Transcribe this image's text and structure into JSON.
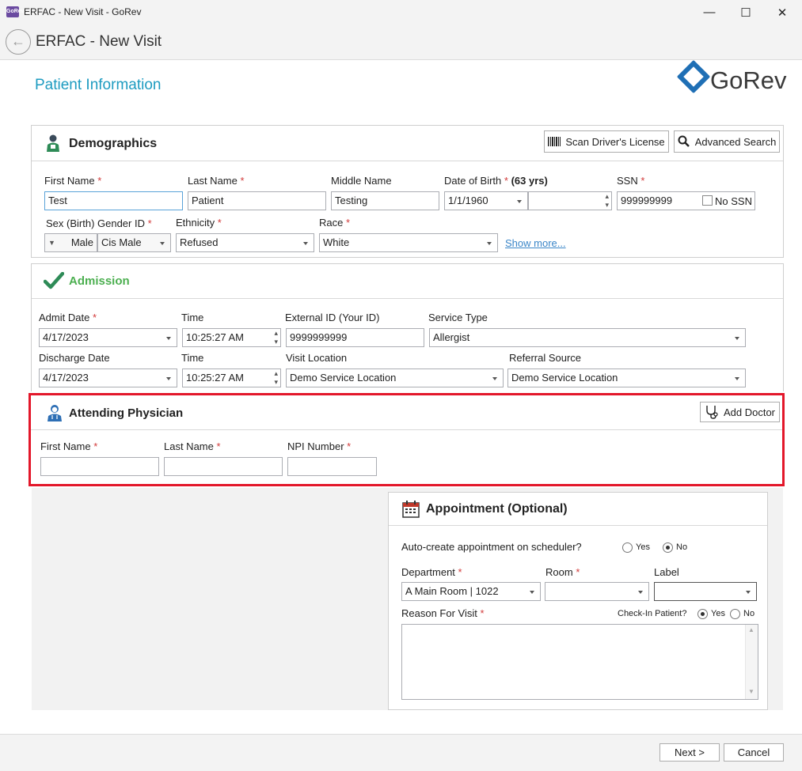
{
  "window": {
    "title": "ERFAC - New Visit - GoRev",
    "app_icon": "GoRev",
    "minimize": "—",
    "maximize": "☐",
    "close": "✕"
  },
  "header": {
    "title": "ERFAC - New Visit",
    "back_icon": "←"
  },
  "page": {
    "title": "Patient Information",
    "logo_text": "GoRev"
  },
  "demographics": {
    "title": "Demographics",
    "scan_button": "Scan Driver's License",
    "search_button": "Advanced Search",
    "first_name_label": "First Name",
    "first_name": "Test",
    "last_name_label": "Last Name",
    "last_name": "Patient",
    "middle_name_label": "Middle Name",
    "middle_name": "Testing",
    "dob_label": "Date of Birth",
    "age": "(63 yrs)",
    "dob": "1/1/1960",
    "dob_time": "",
    "ssn_label": "SSN",
    "ssn": "999999999",
    "no_ssn_label": "No SSN",
    "sex_label": "Sex (Birth)",
    "sex": "Male",
    "gender_label": "Gender ID",
    "gender": "Cis Male",
    "ethnicity_label": "Ethnicity",
    "ethnicity": "Refused",
    "race_label": "Race",
    "race": "White",
    "show_more": "Show more..."
  },
  "admission": {
    "title": "Admission",
    "admit_date_label": "Admit Date",
    "admit_date": "4/17/2023",
    "admit_time_label": "Time",
    "admit_time": "10:25:27 AM",
    "external_id_label": "External ID (Your ID)",
    "external_id": "9999999999",
    "service_type_label": "Service Type",
    "service_type": "Allergist",
    "discharge_date_label": "Discharge Date",
    "discharge_date": "4/17/2023",
    "discharge_time_label": "Time",
    "discharge_time": "10:25:27 AM",
    "visit_location_label": "Visit Location",
    "visit_location": "Demo Service Location",
    "referral_source_label": "Referral Source",
    "referral_source": "Demo Service Location"
  },
  "physician": {
    "title": "Attending Physician",
    "add_button": "Add Doctor",
    "first_name_label": "First Name",
    "first_name": "",
    "last_name_label": "Last Name",
    "last_name": "",
    "npi_label": "NPI Number",
    "npi": ""
  },
  "appointment": {
    "title": "Appointment (Optional)",
    "auto_create_label": "Auto-create appointment on scheduler?",
    "yes": "Yes",
    "no": "No",
    "department_label": "Department",
    "department": "A Main Room | 1022",
    "room_label": "Room",
    "room": "",
    "label_label": "Label",
    "label": "",
    "reason_label": "Reason For Visit",
    "reason": "",
    "checkin_label": "Check-In Patient?"
  },
  "footer": {
    "next": "Next >",
    "cancel": "Cancel"
  },
  "required_mark": "*",
  "colors": {
    "accent": "#1d9bc0",
    "admission_green": "#4caf50",
    "highlight_red": "#e3172a",
    "brand_blue": "#1f6fb5"
  }
}
